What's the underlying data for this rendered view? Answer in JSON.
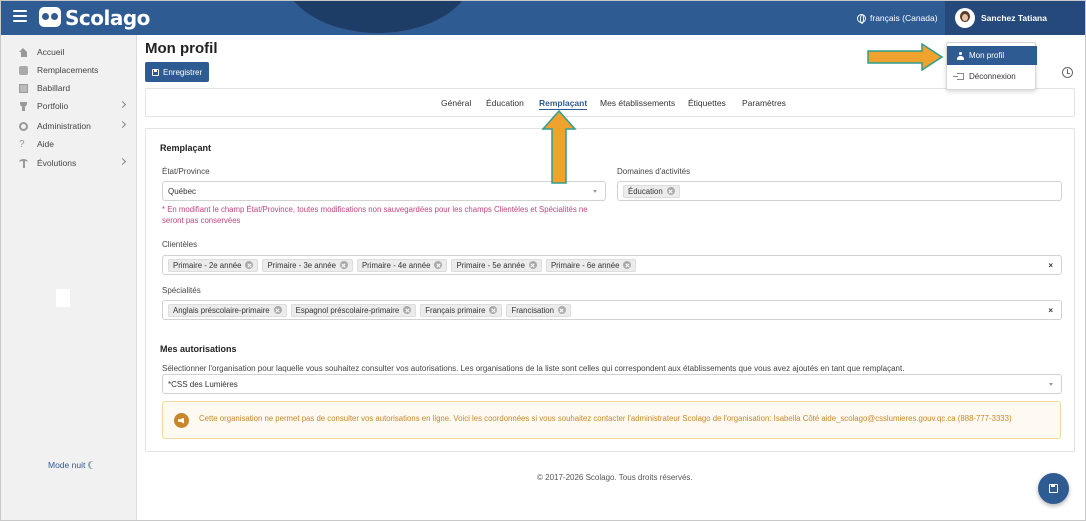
{
  "app": {
    "name": "Scolago"
  },
  "header": {
    "language": "français (Canada)",
    "user_name": "Sanchez Tatiana"
  },
  "user_menu": {
    "items": [
      {
        "label": "Mon profil",
        "icon": "person-icon",
        "active": true
      },
      {
        "label": "Déconnexion",
        "icon": "logout-icon",
        "active": false
      }
    ]
  },
  "sidebar": {
    "items": [
      {
        "label": "Accueil",
        "icon": "home-icon"
      },
      {
        "label": "Remplacements",
        "icon": "replacements-icon"
      },
      {
        "label": "Babillard",
        "icon": "board-icon"
      },
      {
        "label": "Portfolio",
        "icon": "trophy-icon",
        "chevron": true
      },
      {
        "label": "Administration",
        "icon": "gear-icon",
        "chevron": true
      },
      {
        "label": "Aide",
        "icon": "question-icon"
      },
      {
        "label": "Évolutions",
        "icon": "plant-icon",
        "chevron": true
      }
    ],
    "night_mode": "Mode nuit"
  },
  "page": {
    "title": "Mon profil",
    "save_label": "Enregistrer"
  },
  "tabs": [
    {
      "label": "Général"
    },
    {
      "label": "Éducation"
    },
    {
      "label": "Remplaçant",
      "active": true
    },
    {
      "label": "Mes établissements"
    },
    {
      "label": "Étiquettes"
    },
    {
      "label": "Paramètres"
    }
  ],
  "remplacant": {
    "heading": "Remplaçant",
    "etat_label": "État/Province",
    "etat_value": "Québec",
    "etat_warning": "* En modifiant le champ État/Province, toutes modifications non sauvegardées pour les champs Clientèles et Spécialités ne seront pas conservées",
    "domaines_label": "Domaines d'activités",
    "domaines": [
      "Éducation"
    ],
    "clienteles_label": "Clientèles",
    "clienteles": [
      "Primaire - 2e année",
      "Primaire - 3e année",
      "Primaire - 4e année",
      "Primaire - 5e année",
      "Primaire - 6e année"
    ],
    "specialites_label": "Spécialités",
    "specialites": [
      "Anglais préscolaire-primaire",
      "Espagnol préscolaire-primaire",
      "Français primaire",
      "Francisation"
    ],
    "clear_symbol": "×"
  },
  "autorisations": {
    "heading": "Mes autorisations",
    "description": "Sélectionner l'organisation pour laquelle vous souhaitez consulter vos autorisations. Les organisations de la liste sont celles qui correspondent aux établissements que vous avez ajoutés en tant que remplaçant.",
    "org_value": "*CSS des Lumières",
    "alert": "Cette organisation ne permet pas de consulter vos autorisations en ligne. Voici les coordonnées si vous souhaitez contacter l'administrateur Scolago de l'organisation: Isabella Côté aide_scolago@csslumieres.gouv.qc.ca (888-777-3333)"
  },
  "footer": {
    "copyright": "© 2017-2026 Scolago. Tous droits réservés."
  },
  "colors": {
    "brand": "#2f5b93",
    "arrow": "#f0a22e",
    "arrow_outline": "#2f9e8f",
    "warning_text": "#c0467e",
    "alert_text": "#c6882b"
  }
}
